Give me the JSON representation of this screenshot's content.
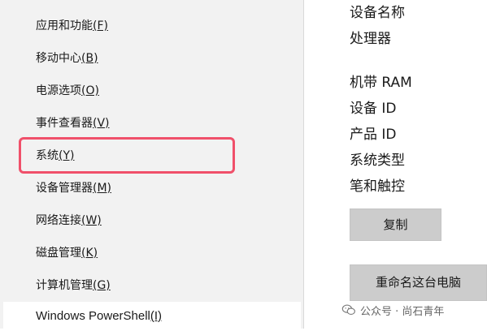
{
  "menu": {
    "items": [
      {
        "label": "应用和功能",
        "key": "(F)"
      },
      {
        "label": "移动中心",
        "key": "(B)"
      },
      {
        "label": "电源选项",
        "key": "(O)"
      },
      {
        "label": "事件查看器",
        "key": "(V)"
      },
      {
        "label": "系统",
        "key": "(Y)"
      },
      {
        "label": "设备管理器",
        "key": "(M)"
      },
      {
        "label": "网络连接",
        "key": "(W)"
      },
      {
        "label": "磁盘管理",
        "key": "(K)"
      },
      {
        "label": "计算机管理",
        "key": "(G)"
      },
      {
        "label": "Windows PowerShell",
        "key": "(I)"
      }
    ],
    "highlight_color": "#f0506a"
  },
  "properties": {
    "device_name": "设备名称",
    "processor": "处理器",
    "ram": "机带 RAM",
    "device_id": "设备 ID",
    "product_id": "产品 ID",
    "system_type": "系统类型",
    "pen_touch": "笔和触控"
  },
  "buttons": {
    "copy": "复制",
    "rename": "重命名这台电脑"
  },
  "watermark": {
    "text": "公众号 · 尚石青年",
    "icon": "wechat-icon"
  }
}
